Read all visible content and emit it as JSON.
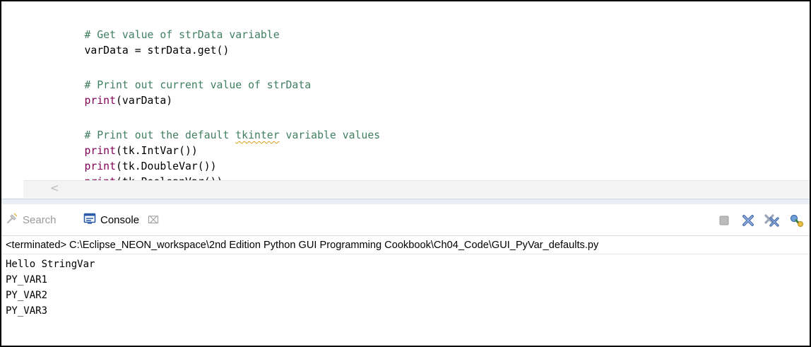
{
  "editor": {
    "lines": [
      {
        "text": "# Get value of strData variable",
        "kind": "comment"
      },
      {
        "text": "varData = strData.get()",
        "kind": "code"
      },
      {
        "text": "# Print out current value of strData",
        "kind": "comment"
      },
      {
        "prefix": "print",
        "rest": "(varData)"
      },
      {
        "text_before": "# Print out the default ",
        "squiggle": "tkinter",
        "text_after": " variable values"
      },
      {
        "prefix": "print",
        "rest": "(tk.IntVar())"
      },
      {
        "prefix": "print",
        "rest": "(tk.DoubleVar())"
      },
      {
        "prefix": "print",
        "rest": "(tk.BooleanVar())"
      }
    ],
    "scroll_left_glyph": "<"
  },
  "views": {
    "search_tab": "Search",
    "console_tab": "Console",
    "console_close": "⌧"
  },
  "toolbar": {
    "icons": [
      "terminate-icon",
      "remove-launch-icon",
      "remove-all-terminated-icon",
      "pin-console-icon"
    ]
  },
  "console": {
    "label": "<terminated> C:\\Eclipse_NEON_workspace\\2nd Edition Python GUI Programming Cookbook\\Ch04_Code\\GUI_PyVar_defaults.py",
    "output": [
      "Hello StringVar",
      "PY_VAR1",
      "PY_VAR2",
      "PY_VAR3"
    ]
  },
  "colors": {
    "comment": "#3f7f5f",
    "builtin": "#7f0055",
    "text": "#000000",
    "squiggle": "#d4a017"
  }
}
